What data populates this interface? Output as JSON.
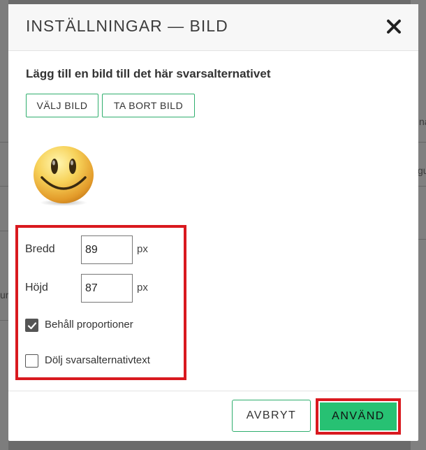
{
  "background": {
    "fragments": [
      "na",
      "gu",
      "ur"
    ]
  },
  "dialog": {
    "title": "INSTÄLLNINGAR — BILD",
    "close_icon": "close-icon",
    "prompt": "Lägg till en bild till det här svarsalternativet",
    "choose_image_label": "VÄLJ BILD",
    "remove_image_label": "TA BORT BILD",
    "image_icon": "smiley-face-icon"
  },
  "size": {
    "width_label": "Bredd",
    "width_value": "89",
    "width_unit": "px",
    "height_label": "Höjd",
    "height_value": "87",
    "height_unit": "px"
  },
  "options": {
    "keep_proportions_label": "Behåll proportioner",
    "keep_proportions_checked": true,
    "hide_text_label": "Dölj svarsalternativtext",
    "hide_text_checked": false
  },
  "footer": {
    "cancel_label": "AVBRYT",
    "apply_label": "ANVÄND"
  },
  "colors": {
    "accent_green": "#27c173",
    "highlight_red": "#d9191f"
  }
}
